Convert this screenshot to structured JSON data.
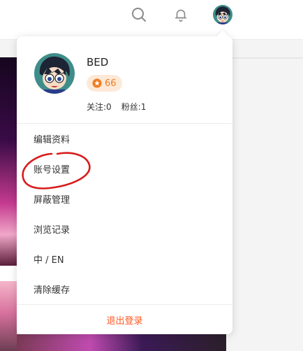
{
  "header": {
    "icons": [
      "search-icon",
      "bell-icon",
      "avatar"
    ]
  },
  "profile": {
    "username": "BED",
    "level": "66",
    "following": "关注:0",
    "followers": "粉丝:1"
  },
  "menu": {
    "items": [
      {
        "label": "编辑资料"
      },
      {
        "label": "账号设置"
      },
      {
        "label": "屏蔽管理"
      },
      {
        "label": "浏览记录"
      },
      {
        "label": "中 / EN"
      },
      {
        "label": "清除缓存"
      }
    ],
    "logout": "退出登录"
  },
  "colors": {
    "accent": "#f07c1e",
    "logout": "#ff5722",
    "annotation": "#d81b1b"
  }
}
